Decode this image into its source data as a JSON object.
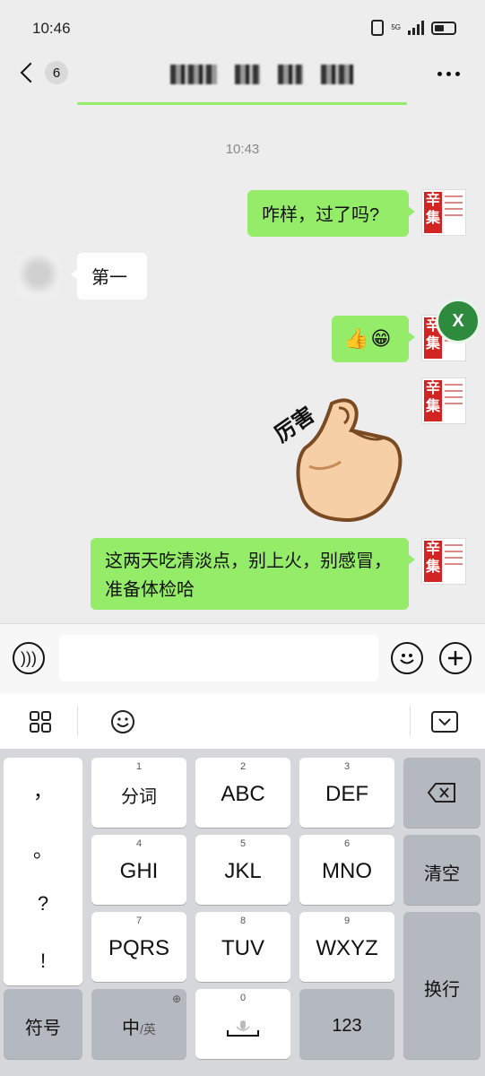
{
  "status_bar": {
    "time": "10:46",
    "network": "5G"
  },
  "header": {
    "unread_count": "6"
  },
  "messages": {
    "timestamp": "10:43",
    "msg1": "咋样，过了吗?",
    "msg2": "第一",
    "msg3_emojis": [
      "👍",
      "😁"
    ],
    "sticker_text": "厉害",
    "msg4": "这两天吃清淡点，别上火，别感冒，准备体检哈",
    "avatar_text": "辛集"
  },
  "floating": {
    "close_label": "X"
  },
  "keyboard": {
    "punctuation": [
      "，",
      "。",
      "?",
      "!"
    ],
    "rows": [
      [
        {
          "num": "1",
          "label": "分词"
        },
        {
          "num": "2",
          "label": "ABC"
        },
        {
          "num": "3",
          "label": "DEF"
        }
      ],
      [
        {
          "num": "4",
          "label": "GHI"
        },
        {
          "num": "5",
          "label": "JKL"
        },
        {
          "num": "6",
          "label": "MNO"
        }
      ],
      [
        {
          "num": "7",
          "label": "PQRS"
        },
        {
          "num": "8",
          "label": "TUV"
        },
        {
          "num": "9",
          "label": "WXYZ"
        }
      ]
    ],
    "clear": "清空",
    "enter": "换行",
    "symbols": "符号",
    "lang_main": "中",
    "lang_alt": "/英",
    "space_num": "0",
    "numbers": "123"
  }
}
